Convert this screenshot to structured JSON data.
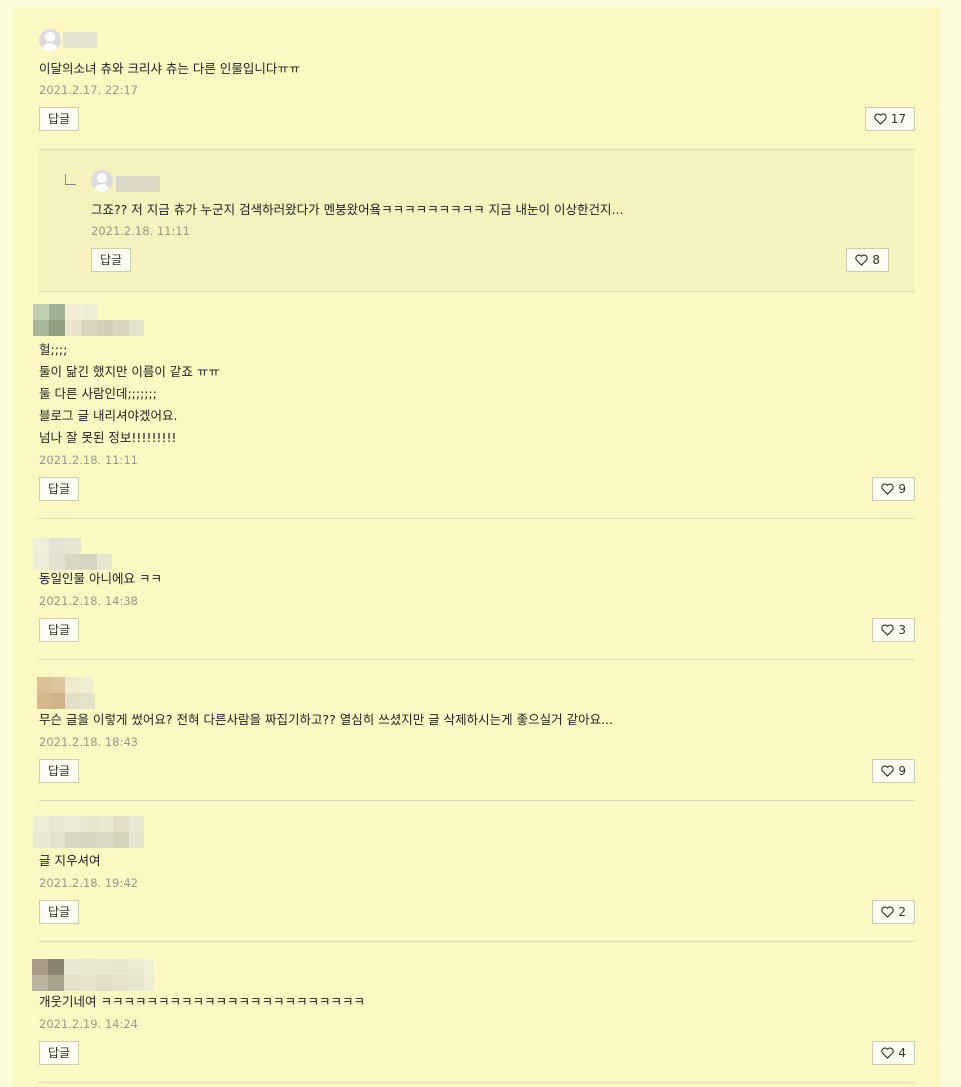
{
  "comments": [
    {
      "text": "이달의소녀 츄와 크리샤 츄는 다른 인물입니다ㅠㅠ",
      "date": "2021.2.17. 22:17",
      "reply_label": "답글",
      "likes": "17",
      "reply": {
        "text": "그죠?? 저 지금 츄가 누군지 검색하러왔다가 멘붕왔어욬ㅋㅋㅋㅋㅋㅋㅋㅋㅋ 지금 내눈이 이상한건지...",
        "date": "2021.2.18. 11:11",
        "reply_label": "답글",
        "likes": "8"
      }
    },
    {
      "text": "헐;;;;\n둘이 닮긴 했지만 이름이 같죠 ㅠㅠ\n둘 다른 사람인데;;;;;;;\n블로그 글 내리셔야겠어요.\n넘나 잘 못된 정보!!!!!!!!!",
      "date": "2021.2.18. 11:11",
      "reply_label": "답글",
      "likes": "9"
    },
    {
      "text": "동일인물 아니에요 ㅋㅋ",
      "date": "2021.2.18. 14:38",
      "reply_label": "답글",
      "likes": "3"
    },
    {
      "text": "무슨 글을 이렇게 썼어요? 전혀 다른사람을 짜집기하고?? 열심히 쓰셨지만 글 삭제하시는게 좋으실거 같아요...",
      "date": "2021.2.18. 18:43",
      "reply_label": "답글",
      "likes": "9"
    },
    {
      "text": "글 지우셔여",
      "date": "2021.2.18. 19:42",
      "reply_label": "답글",
      "likes": "2"
    },
    {
      "text": "개웃기네여 ㅋㅋㅋㅋㅋㅋㅋㅋㅋㅋㅋㅋㅋㅋㅋㅋㅋㅋㅋㅋㅋㅋㅋ",
      "date": "2021.2.19. 14:24",
      "reply_label": "답글",
      "likes": "4"
    }
  ],
  "colors": {
    "background": "#fbf8c4",
    "reply_background": "#f5f2c0",
    "meta_text": "#9a9a8a"
  },
  "icons": {
    "like": "heart-outline-icon",
    "avatar": "default-avatar-icon",
    "reply_indent": "reply-arrow-icon"
  }
}
